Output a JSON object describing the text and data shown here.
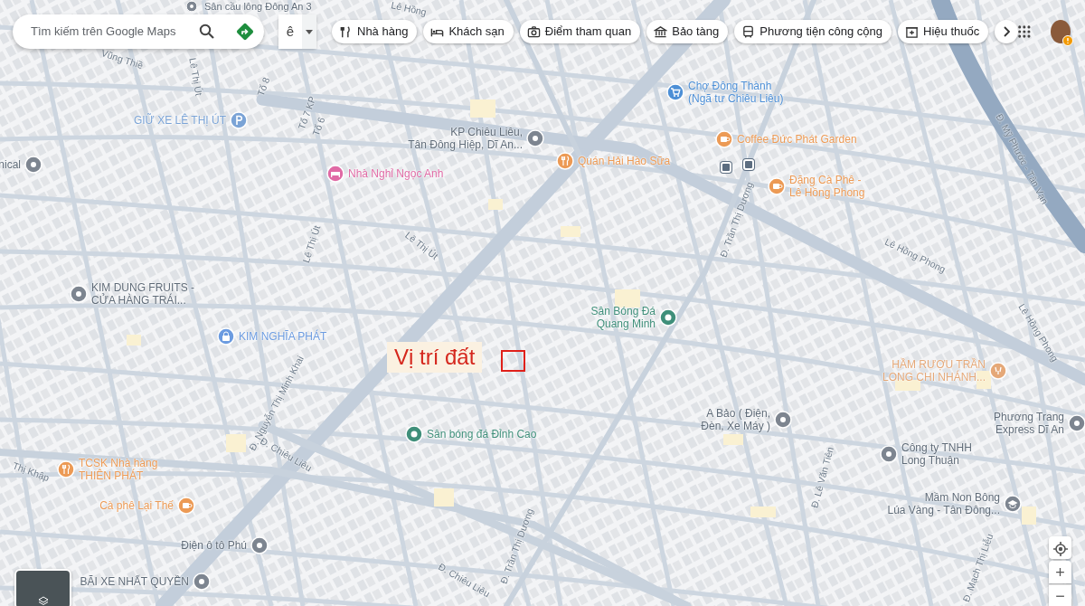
{
  "search": {
    "placeholder": "Tìm kiếm trên Google Maps"
  },
  "input_tool": {
    "label": "ê"
  },
  "chips": [
    {
      "kind": "restaurant",
      "label": "Nhà hàng"
    },
    {
      "kind": "hotel",
      "label": "Khách sạn"
    },
    {
      "kind": "attraction",
      "label": "Điểm tham quan"
    },
    {
      "kind": "museum",
      "label": "Bảo tàng"
    },
    {
      "kind": "transit",
      "label": "Phương tiện công cộng"
    },
    {
      "kind": "pharmacy",
      "label": "Hiệu thuốc"
    }
  ],
  "pois": [
    {
      "kind": "generic",
      "color": "#7d8590",
      "label": [
        "Sân cầu lông Đông An 3"
      ]
    },
    {
      "kind": "parking",
      "color": "#7aa3d6",
      "label": [
        "GIỮ XE LÊ THỊ ÚT"
      ]
    },
    {
      "kind": "generic",
      "color": "#7d8590",
      "label": [
        "nical"
      ]
    },
    {
      "kind": "generic",
      "color": "#7d8590",
      "label": [
        "KP Chiêu Liêu,",
        "Tân Đông Hiệp, Dĩ An..."
      ]
    },
    {
      "kind": "hotel",
      "color": "#e06aa5",
      "label": [
        "Nhà Nghỉ Ngọc Anh"
      ]
    },
    {
      "kind": "shop",
      "color": "#4d8fd6",
      "label": [
        "Chợ Đông Thành",
        "(Ngã tư Chiêu Liêu)"
      ]
    },
    {
      "kind": "cafe",
      "color": "#ec9a55",
      "label": [
        "Coffee Đức Phát Garden"
      ]
    },
    {
      "kind": "restaurant",
      "color": "#ec9a55",
      "label": [
        "Quán Hải Hào Sữa"
      ]
    },
    {
      "kind": "cafe",
      "color": "#ec9a55",
      "label": [
        "Đặng Cà Phê -",
        "Lê Hồng Phong"
      ]
    },
    {
      "kind": "generic",
      "color": "#7d8590",
      "label": [
        "KIM DUNG FRUITS -",
        "CỬA HÀNG TRÁI..."
      ]
    },
    {
      "kind": "bank",
      "color": "#6b9be0",
      "label": [
        "KIM NGHĨA PHÁT"
      ]
    },
    {
      "kind": "stadium",
      "color": "#3f8f7a",
      "label": [
        "Sân Bóng Đá",
        "Quang Minh"
      ]
    },
    {
      "kind": "bar",
      "color": "#e5a878",
      "label": [
        "HẦM RƯỢU TRẦN",
        "LONG CHI NHÁNH..."
      ]
    },
    {
      "kind": "generic",
      "color": "#7d8590",
      "label": [
        "A Bảo ( Điện,",
        "Đèn, Xe Máy )"
      ]
    },
    {
      "kind": "stadium",
      "color": "#3f8f7a",
      "label": [
        "Sân bóng đá Đỉnh Cao"
      ]
    },
    {
      "kind": "generic",
      "color": "#7d8590",
      "label": [
        "Phương Trang",
        "Express Dĩ An"
      ]
    },
    {
      "kind": "generic",
      "color": "#7d8590",
      "label": [
        "Công ty TNHH",
        "Long Thuận"
      ]
    },
    {
      "kind": "restaurant",
      "color": "#ec9a55",
      "label": [
        "TCSK Nhà hàng",
        "THIÊN PHÁT"
      ]
    },
    {
      "kind": "cafe",
      "color": "#ec9a55",
      "label": [
        "Cà phê Lại Thế"
      ]
    },
    {
      "kind": "school",
      "color": "#7d8590",
      "label": [
        "Mầm Non Bông",
        "Lúa Vàng - Tân Đông..."
      ]
    },
    {
      "kind": "generic",
      "color": "#7d8590",
      "label": [
        "Điện ô tô Phú"
      ]
    },
    {
      "kind": "generic",
      "color": "#7d8590",
      "label": [
        "BÃI XE NHẤT QUYỀN"
      ]
    }
  ],
  "streets": [
    "Vũng Thiề",
    "Lê Thị Út",
    "Tổ 8",
    "Tổ 7 KP",
    "Tổ 6",
    "Lê Thị Út",
    "Lê Thị Út",
    "Lê Hồng",
    "Đ. Trần Thị Dương",
    "Lê Hồng Phong",
    "Lê Hồng Phong",
    "Đ. Mỹ Phước - Tân Vạn",
    "Đ. Nguyễn Thị Minh Khai",
    "Đ. Chiêu Liêu",
    "Thị Khập",
    "Đ. Lê Văn Tiên",
    "Đ. Trần Thị Dương",
    "Đ. Chiêu Liêu",
    "Đ. Mạch Thị Liễu"
  ],
  "annotation": {
    "label": "Vị trí đất"
  },
  "zoom_controls": {
    "zoom_in": "+",
    "zoom_out": "−"
  }
}
